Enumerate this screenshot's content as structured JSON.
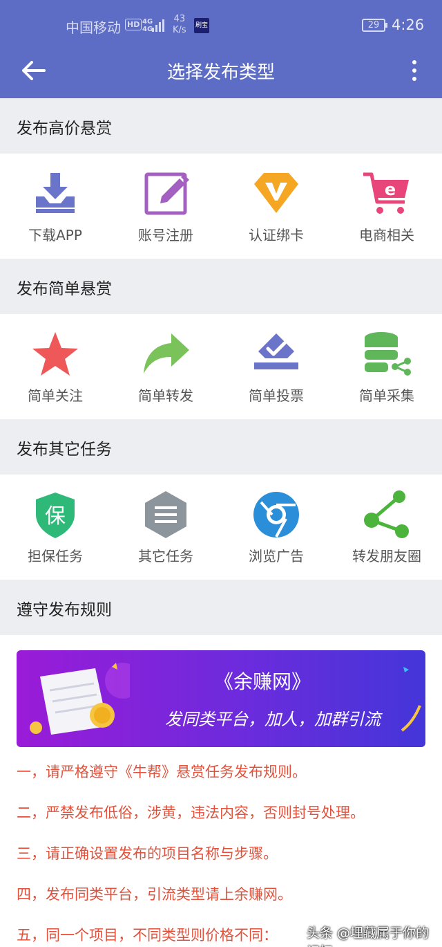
{
  "status_bar": {
    "carrier": "中国移动",
    "hd": "HD",
    "net_top": "4G",
    "net_bottom": "4G",
    "speed_value": "43",
    "speed_unit": "K/s",
    "app_badge": "刷宝",
    "battery": "29",
    "time": "4:26"
  },
  "app_bar": {
    "title": "选择发布类型",
    "back_icon": "arrow-left-icon",
    "more_icon": "more-vert-icon"
  },
  "sections": [
    {
      "title": "发布高价悬赏",
      "items": [
        {
          "label": "下载APP",
          "icon": "download-icon",
          "color": "#6a74c9"
        },
        {
          "label": "账号注册",
          "icon": "edit-icon",
          "color": "#a460c0"
        },
        {
          "label": "认证绑卡",
          "icon": "vip-diamond-icon",
          "color": "#f5a623"
        },
        {
          "label": "电商相关",
          "icon": "shopping-cart-icon",
          "color": "#e8457a"
        }
      ]
    },
    {
      "title": "发布简单悬赏",
      "items": [
        {
          "label": "简单关注",
          "icon": "star-icon",
          "color": "#ee5858"
        },
        {
          "label": "简单转发",
          "icon": "share-arrow-icon",
          "color": "#7ac35a"
        },
        {
          "label": "简单投票",
          "icon": "vote-icon",
          "color": "#6a74c9"
        },
        {
          "label": "简单采集",
          "icon": "database-icon",
          "color": "#5fb75a"
        }
      ]
    },
    {
      "title": "发布其它任务",
      "items": [
        {
          "label": "担保任务",
          "icon": "shield-icon",
          "color": "#2fb978",
          "glyph": "保"
        },
        {
          "label": "其它任务",
          "icon": "list-hexagon-icon",
          "color": "#8c949c"
        },
        {
          "label": "浏览广告",
          "icon": "browser-icon",
          "color": "#2a8fd8"
        },
        {
          "label": "转发朋友圈",
          "icon": "share-nodes-icon",
          "color": "#4cb43c"
        }
      ]
    }
  ],
  "rules_section": {
    "title": "遵守发布规则",
    "banner": {
      "title": "《余赚网》",
      "subtitle": "发同类平台，加人，加群引流"
    },
    "rules": [
      "一，请严格遵守《牛帮》悬赏任务发布规则。",
      "二，严禁发布低俗，涉黄，违法内容，否则封号处理。",
      "三，请正确设置发布的项目名称与步骤。",
      "四，发布同类平台，引流类型请上余赚网。",
      "五，同一个项目，不同类型则价格不同："
    ]
  },
  "watermark": "头条 @埋藏属于你的记忆"
}
